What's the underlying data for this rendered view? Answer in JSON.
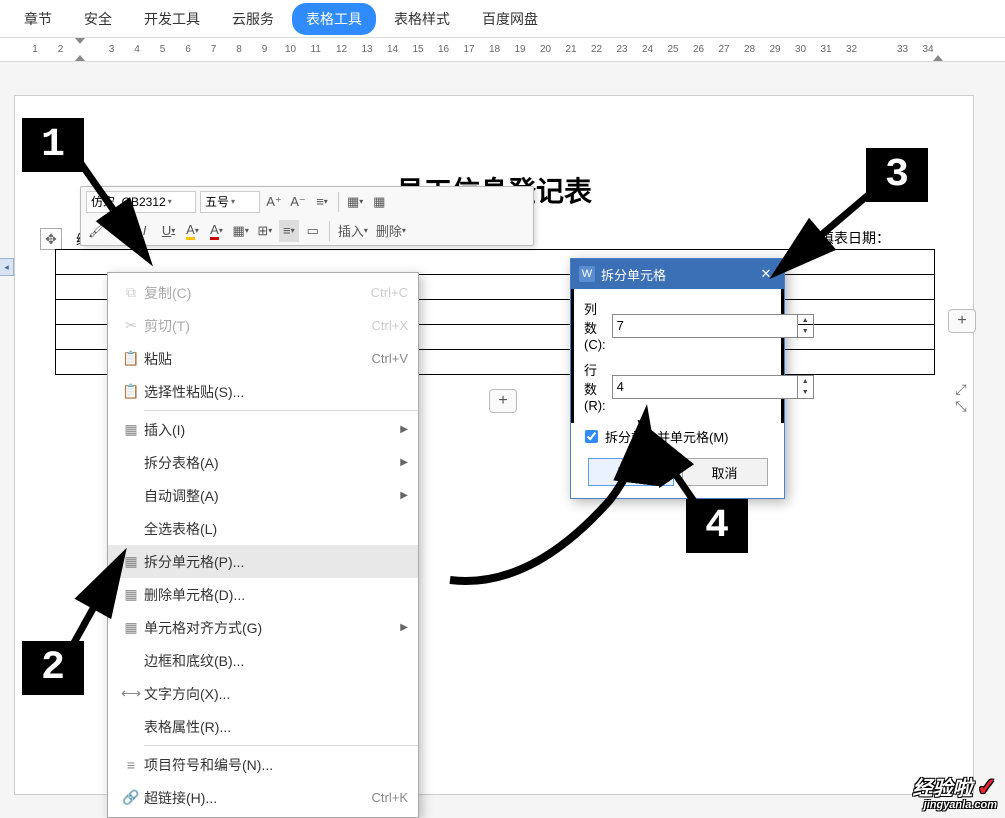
{
  "menubar": {
    "items": [
      "章节",
      "安全",
      "开发工具",
      "云服务",
      "表格工具",
      "表格样式",
      "百度网盘"
    ],
    "active_index": 4
  },
  "ruler": {
    "numbers": [
      "1",
      "2",
      "",
      "3",
      "4",
      "5",
      "6",
      "7",
      "8",
      "9",
      "10",
      "11",
      "12",
      "13",
      "14",
      "15",
      "16",
      "17",
      "18",
      "19",
      "20",
      "21",
      "22",
      "23",
      "24",
      "25",
      "26",
      "27",
      "28",
      "29",
      "30",
      "31",
      "32",
      "",
      "33",
      "34"
    ]
  },
  "doc": {
    "title": "员工信息登记表",
    "fill_date_label": "填表日期：",
    "left_label": "编号",
    "move_glyph": "✥"
  },
  "mini_toolbar": {
    "font_name": "仿宋_GB2312",
    "font_size": "五号",
    "insert_label": "插入",
    "delete_label": "删除"
  },
  "add_btn": {
    "plus": "+"
  },
  "expand": {
    "in": "⤡",
    "out": "⤢"
  },
  "ctx": {
    "items": [
      {
        "icon": "⧉",
        "label": "复制(C)",
        "shortcut": "Ctrl+C",
        "disabled": true
      },
      {
        "icon": "✂",
        "label": "剪切(T)",
        "shortcut": "Ctrl+X",
        "disabled": true
      },
      {
        "icon": "📋",
        "label": "粘贴",
        "shortcut": "Ctrl+V"
      },
      {
        "icon": "📋",
        "label": "选择性粘贴(S)..."
      },
      {
        "sep": true
      },
      {
        "icon": "▦",
        "label": "插入(I)",
        "arrow": true
      },
      {
        "label": "拆分表格(A)",
        "arrow": true
      },
      {
        "label": "自动调整(A)",
        "arrow": true
      },
      {
        "label": "全选表格(L)"
      },
      {
        "icon": "▦",
        "label": "拆分单元格(P)...",
        "highlight": true
      },
      {
        "icon": "▦",
        "label": "删除单元格(D)..."
      },
      {
        "icon": "▦",
        "label": "单元格对齐方式(G)",
        "arrow": true
      },
      {
        "label": "边框和底纹(B)..."
      },
      {
        "icon": "⟷",
        "label": "文字方向(X)..."
      },
      {
        "label": "表格属性(R)..."
      },
      {
        "sep": true
      },
      {
        "icon": "≡",
        "label": "项目符号和编号(N)..."
      },
      {
        "icon": "🔗",
        "label": "超链接(H)...",
        "shortcut": "Ctrl+K"
      }
    ]
  },
  "dialog": {
    "icon": "W",
    "title": "拆分单元格",
    "close": "✕",
    "cols_label": "列数(C):",
    "cols_value": "7",
    "rows_label": "行数(R):",
    "rows_value": "4",
    "merge_label": "拆分前合并单元格(M)",
    "ok": "确定",
    "cancel": "取消",
    "spin_up": "▲",
    "spin_down": "▼"
  },
  "badges": {
    "b1": "1",
    "b2": "2",
    "b3": "3",
    "b4": "4"
  },
  "watermark": {
    "line1": "经验啦",
    "check": "✓",
    "line2": "jingyanla.com"
  }
}
